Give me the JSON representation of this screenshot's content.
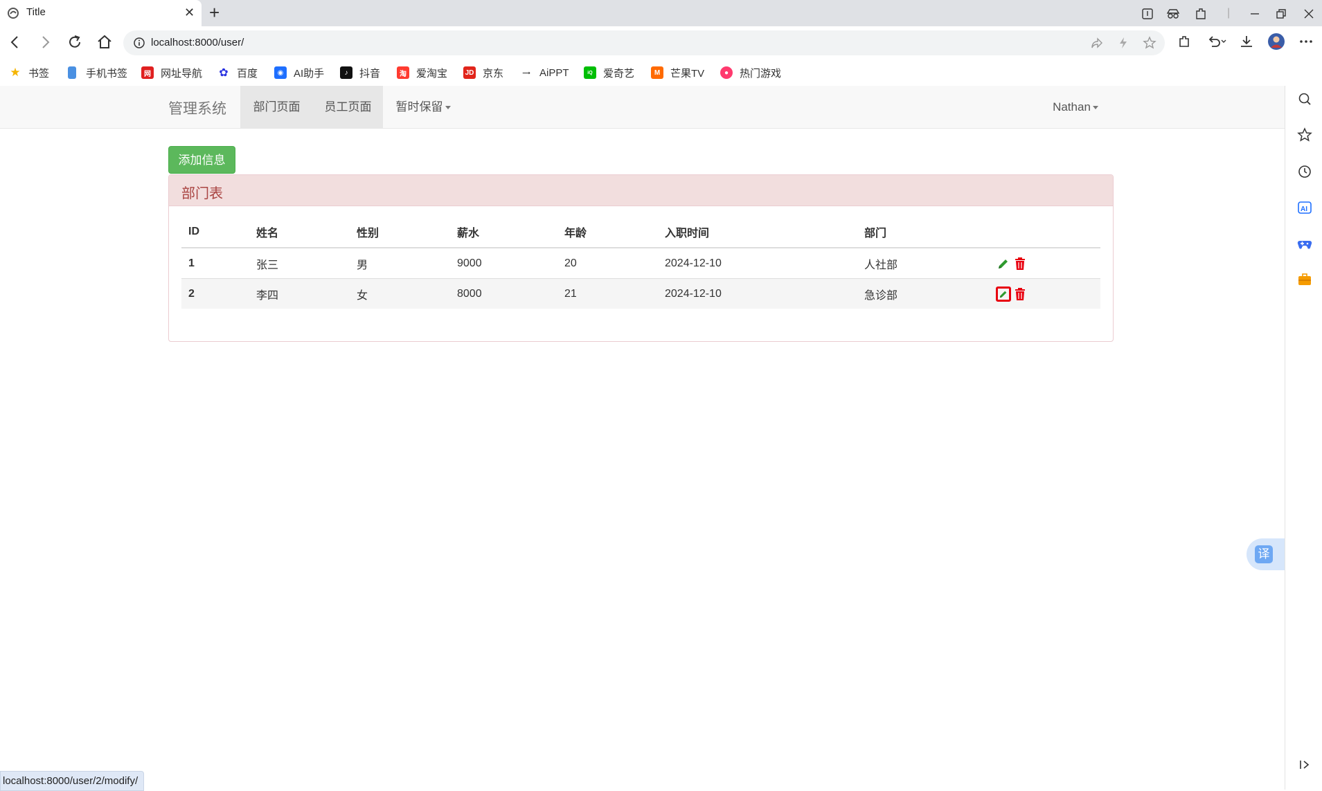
{
  "browser": {
    "tab_title": "Title",
    "url": "localhost:8000/user/",
    "status_url": "localhost:8000/user/2/modify/",
    "bookmarks": [
      {
        "label": "书签",
        "icon": "star-icon",
        "color": "#f5b400"
      },
      {
        "label": "手机书签",
        "icon": "phone-icon",
        "color": "#4a90e2"
      },
      {
        "label": "网址导航",
        "icon": "nav-site-icon",
        "color": "#e02020"
      },
      {
        "label": "百度",
        "icon": "baidu-icon",
        "color": "#2932e1"
      },
      {
        "label": "AI助手",
        "icon": "ai-assistant-icon",
        "color": "#1e6fff"
      },
      {
        "label": "抖音",
        "icon": "douyin-icon",
        "color": "#111111"
      },
      {
        "label": "爱淘宝",
        "icon": "taobao-icon",
        "color": "#ff3b30"
      },
      {
        "label": "京东",
        "icon": "jd-icon",
        "color": "#e1251b"
      },
      {
        "label": "AiPPT",
        "icon": "aippt-icon",
        "color": "#333333"
      },
      {
        "label": "爱奇艺",
        "icon": "iqiyi-icon",
        "color": "#00be06"
      },
      {
        "label": "芒果TV",
        "icon": "mango-tv-icon",
        "color": "#ff6a00"
      },
      {
        "label": "热门游戏",
        "icon": "games-icon",
        "color": "#ff3a6e"
      }
    ]
  },
  "navbar": {
    "brand": "管理系统",
    "items": [
      {
        "label": "部门页面",
        "active": true
      },
      {
        "label": "员工页面",
        "active": true
      },
      {
        "label": "暂时保留",
        "dropdown": true
      }
    ],
    "user": "Nathan"
  },
  "main": {
    "add_button": "添加信息",
    "panel_title": "部门表",
    "columns": [
      "ID",
      "姓名",
      "性别",
      "薪水",
      "年龄",
      "入职时间",
      "部门",
      ""
    ],
    "rows": [
      {
        "id": "1",
        "name": "张三",
        "gender": "男",
        "salary": "9000",
        "age": "20",
        "join_date": "2024-12-10",
        "department": "人社部"
      },
      {
        "id": "2",
        "name": "李四",
        "gender": "女",
        "salary": "8000",
        "age": "21",
        "join_date": "2024-12-10",
        "department": "急诊部"
      }
    ]
  },
  "translate_button": "译",
  "colors": {
    "success": "#5cb85c",
    "panel_danger_bg": "#f2dede",
    "panel_danger_text": "#a94442",
    "edit_icon": "#2e9a2e",
    "delete_icon": "#e8000f"
  }
}
